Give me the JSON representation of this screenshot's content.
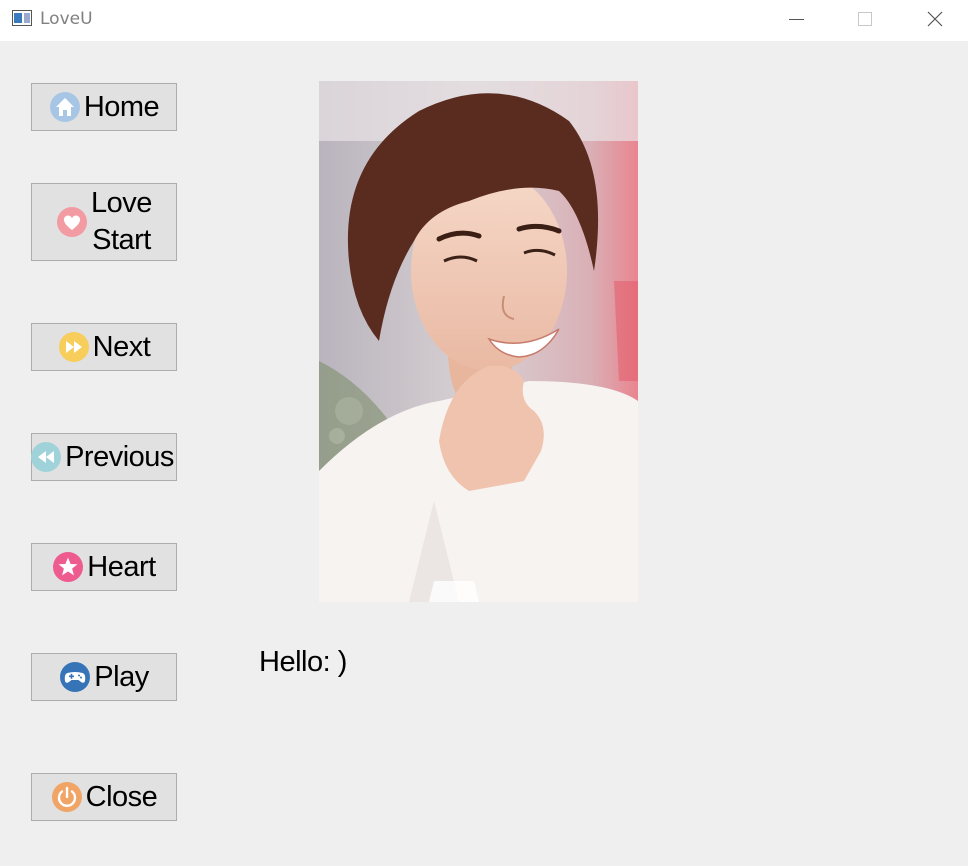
{
  "window": {
    "title": "LoveU",
    "controls": {
      "minimize": "minimize-icon",
      "maximize": "maximize-icon",
      "close": "close-icon"
    }
  },
  "sidebar": {
    "buttons": [
      {
        "label": "Home",
        "icon": "home-icon",
        "icon_color": "#a7c6e6"
      },
      {
        "label_line1": "Love",
        "label_line2": "Start",
        "icon": "heart-icon",
        "icon_color": "#f29ba2"
      },
      {
        "label": "Next",
        "icon": "fast-forward-icon",
        "icon_color": "#f7cd5c"
      },
      {
        "label": "Previous",
        "icon": "rewind-icon",
        "icon_color": "#9fd3d9"
      },
      {
        "label": "Heart",
        "icon": "star-icon",
        "icon_color": "#ee5b8f"
      },
      {
        "label": "Play",
        "icon": "gamepad-icon",
        "icon_color": "#3674b7"
      },
      {
        "label": "Close",
        "icon": "power-icon",
        "icon_color": "#f0a466"
      }
    ]
  },
  "main": {
    "greeting": "Hello: )"
  },
  "colors": {
    "window_bg": "#efefef",
    "titlebar_bg": "#ffffff",
    "button_bg": "#e1e1e1",
    "button_border": "#adadad"
  }
}
